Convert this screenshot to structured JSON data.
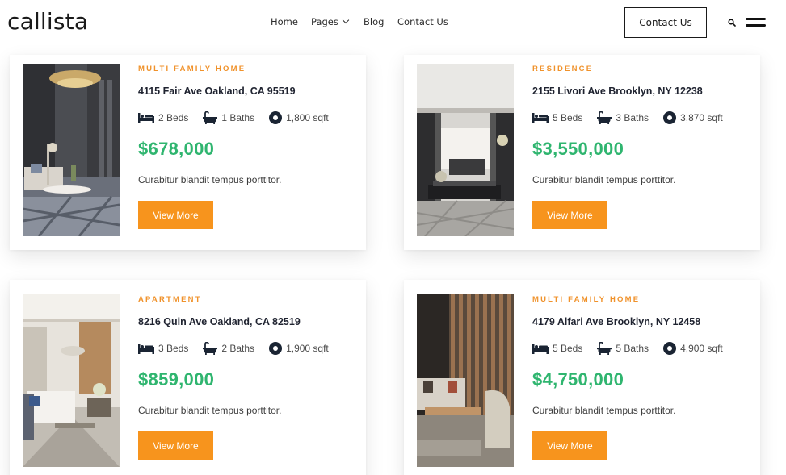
{
  "header": {
    "logo": "callista",
    "nav": {
      "home": "Home",
      "pages": "Pages",
      "blog": "Blog",
      "contact": "Contact Us"
    },
    "cta": "Contact Us"
  },
  "listings": [
    {
      "type": "MULTI FAMILY HOME",
      "address": "4115 Fair Ave Oakland, CA 95519",
      "beds": "2 Beds",
      "baths": "1 Baths",
      "area": "1,800 sqft",
      "price": "$678,000",
      "description": "Curabitur blandit tempus porttitor.",
      "button": "View More"
    },
    {
      "type": "RESIDENCE",
      "address": "2155 Livori Ave Brooklyn, NY 12238",
      "beds": "5 Beds",
      "baths": "3 Baths",
      "area": "3,870 sqft",
      "price": "$3,550,000",
      "description": "Curabitur blandit tempus porttitor.",
      "button": "View More"
    },
    {
      "type": "APARTMENT",
      "address": "8216 Quin Ave Oakland, CA 82519",
      "beds": "3 Beds",
      "baths": "2 Baths",
      "area": "1,900 sqft",
      "price": "$859,000",
      "description": "Curabitur blandit tempus porttitor.",
      "button": "View More"
    },
    {
      "type": "MULTI FAMILY HOME",
      "address": "4179 Alfari Ave Brooklyn, NY 12458",
      "beds": "5 Beds",
      "baths": "5 Baths",
      "area": "4,900 sqft",
      "price": "$4,750,000",
      "description": "Curabitur blandit tempus porttitor.",
      "button": "View More"
    }
  ],
  "colors": {
    "accent": "#f7941d",
    "price": "#2fb56f",
    "type_label": "#f0922b",
    "text": "#1f2330"
  },
  "icons": {
    "beds": "bed-icon",
    "baths": "bathtub-icon",
    "area": "area-icon",
    "search": "search-icon",
    "menu": "menu-icon"
  }
}
